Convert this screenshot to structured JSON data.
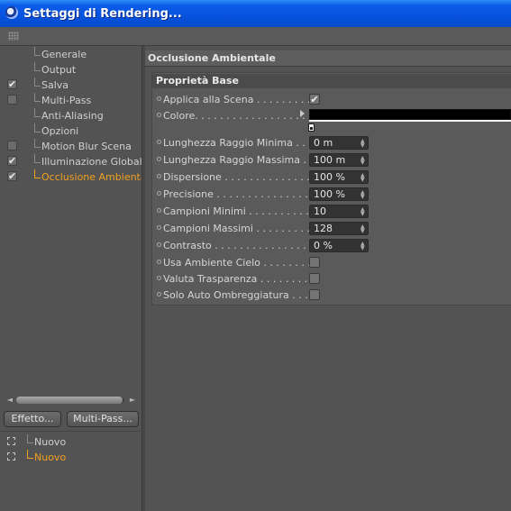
{
  "window": {
    "title": "Settaggi di Rendering..."
  },
  "sidebar": {
    "items": [
      {
        "label": "Generale",
        "checkbox": null,
        "selected": false
      },
      {
        "label": "Output",
        "checkbox": null,
        "selected": false
      },
      {
        "label": "Salva",
        "checkbox": "checked",
        "selected": false
      },
      {
        "label": "Multi-Pass",
        "checkbox": "unchecked",
        "selected": false
      },
      {
        "label": "Anti-Aliasing",
        "checkbox": null,
        "selected": false
      },
      {
        "label": "Opzioni",
        "checkbox": null,
        "selected": false
      },
      {
        "label": "Motion Blur Scena",
        "checkbox": "unchecked",
        "selected": false
      },
      {
        "label": "Illuminazione Globale",
        "checkbox": "checked",
        "selected": false
      },
      {
        "label": "Occlusione Ambientale",
        "checkbox": "checked",
        "selected": true
      }
    ],
    "buttons": {
      "effect": "Effetto...",
      "multipass": "Multi-Pass..."
    },
    "takes": [
      {
        "label": "Nuovo",
        "selected": false
      },
      {
        "label": "Nuovo",
        "selected": true
      }
    ]
  },
  "main": {
    "section_title": "Occlusione Ambientale",
    "group_title": "Proprietà Base",
    "properties": {
      "apply": {
        "label": "Applica alla Scena . . . . . . . . . .",
        "checked": true
      },
      "color": {
        "label": "Colore. . . . . . . . . . . . . . . . . . . . . . .",
        "swatch": "#000000"
      },
      "min_ray": {
        "label": "Lunghezza Raggio Minima . . . . .",
        "value": "0 m"
      },
      "max_ray": {
        "label": "Lunghezza Raggio Massima . . .",
        "value": "100 m"
      },
      "dispersion": {
        "label": "Dispersione . . . . . . . . . . . . . . . .",
        "value": "100 %"
      },
      "precision": {
        "label": "Precisione . . . . . . . . . . . . . . . . .",
        "value": "100 %"
      },
      "min_samples": {
        "label": "Campioni Minimi . . . . . . . . . . . . .",
        "value": "10"
      },
      "max_samples": {
        "label": "Campioni Massimi . . . . . . . . . . . .",
        "value": "128"
      },
      "contrast": {
        "label": "Contrasto . . . . . . . . . . . . . . . . .",
        "value": "0 %"
      },
      "sky_env": {
        "label": "Usa Ambiente Cielo . . . . . . . . . .",
        "checked": false
      },
      "eval_transp": {
        "label": "Valuta Trasparenza . . . . . . . . . . .",
        "checked": false
      },
      "self_shadow": {
        "label": "Solo Auto Ombreggiatura . . . . . .",
        "checked": false
      }
    }
  },
  "colors": {
    "accent": "#f0a020",
    "titlebar": "#0a5ce8",
    "panel": "#535353"
  }
}
